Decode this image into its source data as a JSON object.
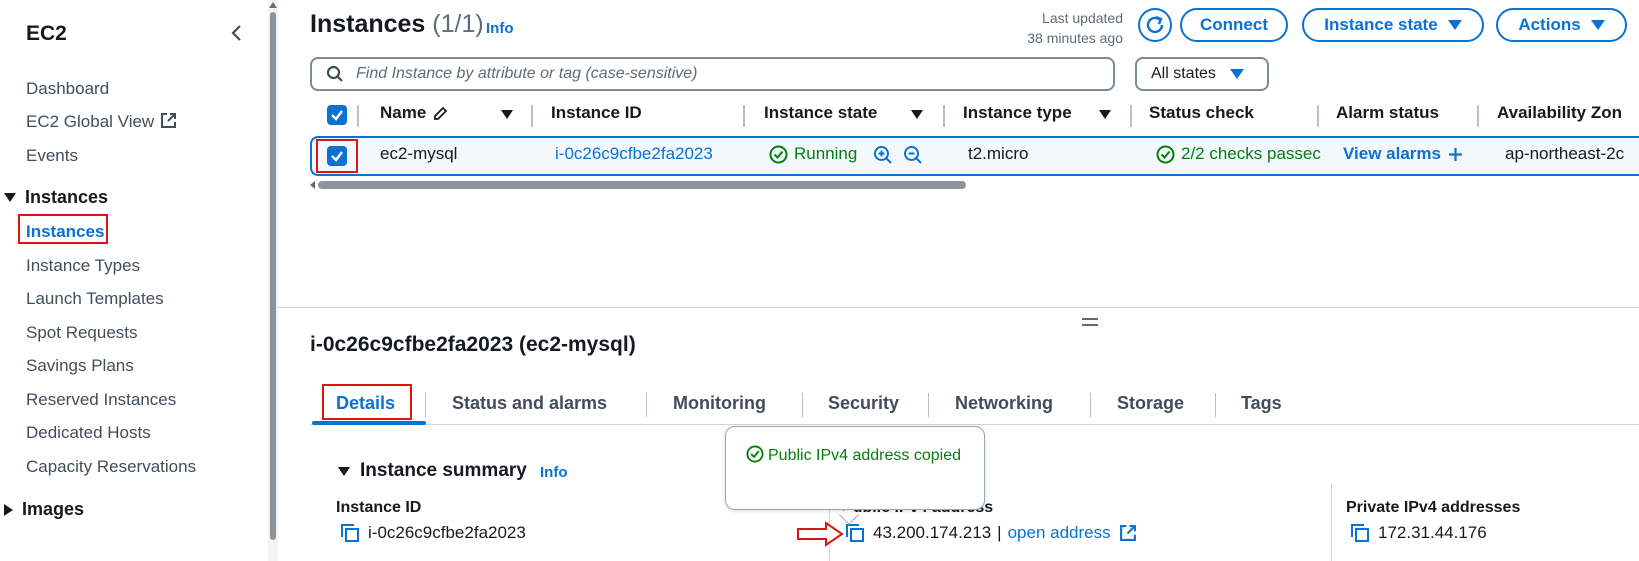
{
  "sidebar": {
    "title": "EC2",
    "items_top": [
      "Dashboard",
      "EC2 Global View",
      "Events"
    ],
    "section_instances": "Instances",
    "instances_items": [
      "Instances",
      "Instance Types",
      "Launch Templates",
      "Spot Requests",
      "Savings Plans",
      "Reserved Instances",
      "Dedicated Hosts",
      "Capacity Reservations"
    ],
    "section_images": "Images",
    "active_item": "Instances"
  },
  "header": {
    "title": "Instances",
    "count": "(1/1)",
    "info": "Info",
    "last_updated_line1": "Last updated",
    "last_updated_line2": "38 minutes ago",
    "connect": "Connect",
    "instance_state": "Instance state",
    "actions": "Actions"
  },
  "search": {
    "placeholder": "Find Instance by attribute or tag (case-sensitive)",
    "states_filter": "All states"
  },
  "table": {
    "columns": [
      "Name",
      "Instance ID",
      "Instance state",
      "Instance type",
      "Status check",
      "Alarm status",
      "Availability Zon"
    ],
    "row": {
      "name": "ec2-mysql",
      "instance_id": "i-0c26c9cfbe2fa2023",
      "state": "Running",
      "type": "t2.micro",
      "status_check": "2/2 checks passec",
      "alarm": "View alarms",
      "az": "ap-northeast-2c"
    }
  },
  "details": {
    "title": "i-0c26c9cfbe2fa2023 (ec2-mysql)",
    "tabs": [
      "Details",
      "Status and alarms",
      "Monitoring",
      "Security",
      "Networking",
      "Storage",
      "Tags"
    ],
    "active_tab": "Details",
    "summary_title": "Instance summary",
    "summary_info": "Info",
    "instance_id_label": "Instance ID",
    "instance_id_value": "i-0c26c9cfbe2fa2023",
    "public_ip_label": "Public IPv4 address",
    "public_ip_value": "43.200.174.213",
    "public_ip_sep": "|",
    "open_address": "open address",
    "private_ip_label": "Private IPv4 addresses",
    "private_ip_value": "172.31.44.176",
    "popover_text": "Public IPv4 address copied"
  },
  "colors": {
    "accent": "#0972d3",
    "success": "#037f0c",
    "highlight": "#d91515"
  }
}
